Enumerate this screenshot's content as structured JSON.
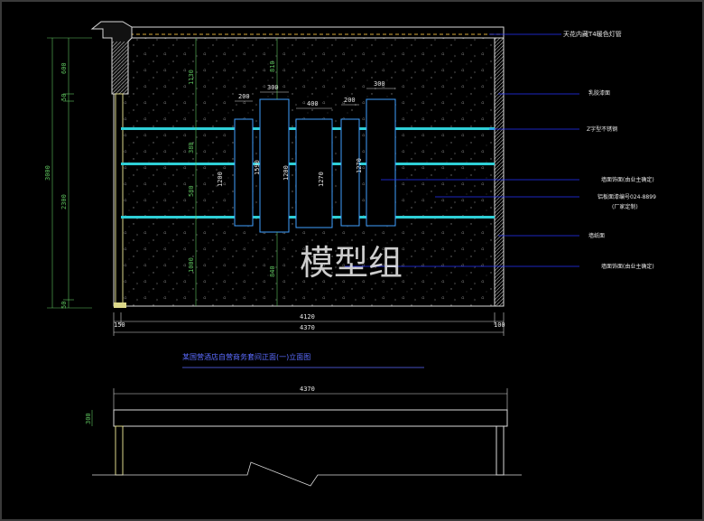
{
  "colors": {
    "background": "#000000",
    "frame": "#3a3a3a",
    "outline": "#d9d9d9",
    "panel": "#3fa0ff",
    "rail": "#2ecfd6",
    "dimension_text": "#e8e8e8",
    "dimension_green": "#5ec45e",
    "leader": "#2633ff",
    "title": "#5b6cff",
    "light_strip": "#d6a73a",
    "column": "#ddd98a"
  },
  "plan": {
    "title": "某国营酒店自营商务套间正面(一)立面图",
    "span_dim": "4370",
    "height_dim": "300"
  },
  "elevation": {
    "annotations": {
      "ceiling_light": "天花内藏T4暖色灯管",
      "wall_finish_top": "乳胶漆面",
      "rail": "Z字型不锈钢",
      "panel_note_1": "墙面饰面(由业主确定)",
      "panel_note_2": "铝板面漆编号024-8899",
      "panel_note_3": "(厂家定制)",
      "wall_finish_bottom": "墙纸面",
      "bottom_note": "墙面饰面(由业主确定)"
    },
    "bottom_dims": {
      "left": "150",
      "mid": "4120",
      "right": "100",
      "total": "4370"
    },
    "left_dims": {
      "total": "3000",
      "upper": "600",
      "gap1": "50",
      "main": "2300",
      "gap2": "50"
    },
    "inner_dims": {
      "top": "1130",
      "mid": "380",
      "low": "580",
      "bottom": "1000",
      "top2": "810",
      "bottom2": "840"
    },
    "panel_widths": {
      "p1": "200",
      "p2": "300",
      "p3": "400",
      "p4": "200",
      "p5": "300"
    },
    "panel_heights": {
      "p1": "1200",
      "p2": "1590",
      "p3": "1200",
      "p4": "1270",
      "p5": "1270"
    }
  },
  "watermark": "模型组"
}
